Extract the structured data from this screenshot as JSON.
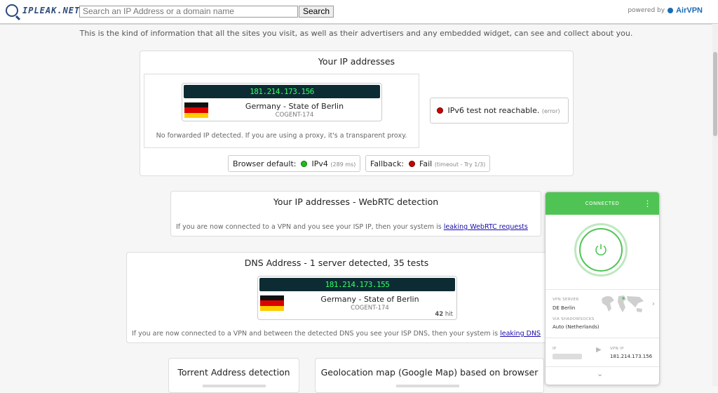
{
  "header": {
    "logo_text": "IPLEAK.NET",
    "search_placeholder": "Search an IP Address or a domain name",
    "search_button": "Search",
    "powered_by": "powered by",
    "brand": "AirVPN"
  },
  "intro": "This is the kind of information that all the sites you visit, as well as their advertisers and any embedded widget, can see and collect about you.",
  "ip_section": {
    "title": "Your IP addresses",
    "ip": "181.214.173.156",
    "location": "Germany - State of Berlin",
    "isp": "COGENT-174",
    "proxy_note": "No forwarded IP detected. If you are using a proxy, it's a transparent proxy.",
    "ipv6_text": "IPv6 test not reachable.",
    "ipv6_status": "(error)",
    "browser_default_label": "Browser default:",
    "browser_default_value": "IPv4",
    "browser_default_time": "(289 ms)",
    "fallback_label": "Fallback:",
    "fallback_value": "Fail",
    "fallback_detail": "(timeout - Try 1/3)"
  },
  "webrtc_section": {
    "title": "Your IP addresses - WebRTC detection",
    "note": "If you are now connected to a VPN and you see your ISP IP, then your system is",
    "link": "leaking WebRTC requests"
  },
  "dns_section": {
    "title": "DNS Address - 1 server detected, 35 tests",
    "ip": "181.214.173.155",
    "location": "Germany - State of Berlin",
    "isp": "COGENT-174",
    "hits": "42",
    "hit_label": "hit",
    "note": "If you are now connected to a VPN and between the detected DNS you see your ISP DNS, then your system is",
    "link": "leaking DNS"
  },
  "torrent_section": {
    "title": "Torrent Address detection"
  },
  "geo_section": {
    "title": "Geolocation map (Google Map) based on browser"
  },
  "vpn_widget": {
    "status": "CONNECTED",
    "menu": "⋮",
    "server_label": "VPN SERVER",
    "server_value": "DE Berlin",
    "via_label": "VIA SHADOWSOCKS",
    "via_value": "Auto (Netherlands)",
    "ip_label": "IP",
    "vpn_ip_label": "VPN IP",
    "vpn_ip_value": "181.214.173.156"
  },
  "colors": {
    "vpn_green": "#4fc454",
    "ip_display_bg": "#0d2b33",
    "ip_display_text": "#33ff66",
    "link": "#1a0dab"
  }
}
